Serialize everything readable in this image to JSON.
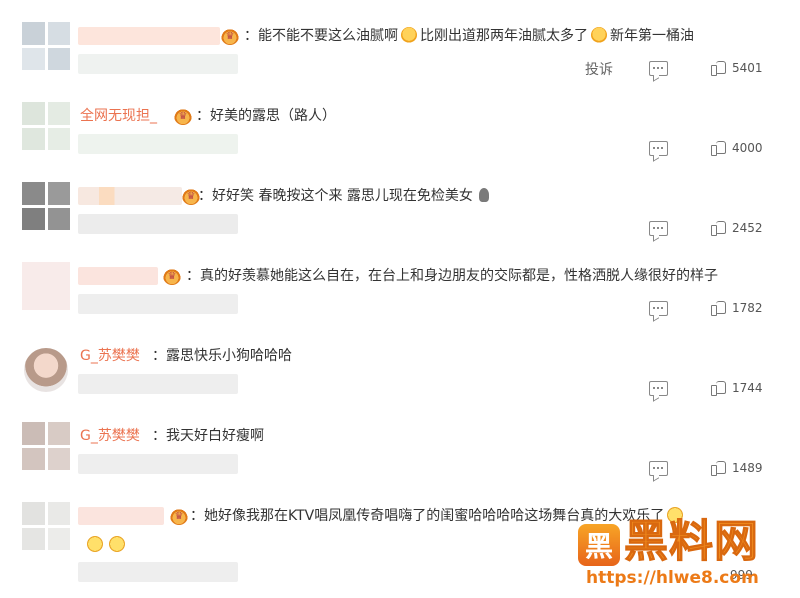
{
  "comments": [
    {
      "text": "能不能不要这么油腻啊",
      "text2": "比刚出道那两年油腻太多了",
      "text3": "新年第一桶油",
      "report": "投诉",
      "likes": "5401"
    },
    {
      "name": "全网无现担_",
      "text": "好美的露思（路人）",
      "likes": "4000"
    },
    {
      "text": "好好笑 春晚按这个来 露思儿现在免检美女",
      "likes": "2452"
    },
    {
      "text": "真的好羡慕她能这么自在，在台上和身边朋友的交际都是，性格洒脱人缘很好的样子",
      "likes": "1782"
    },
    {
      "name": "G_苏樊樊",
      "text": "露思快乐小狗哈哈哈",
      "likes": "1744"
    },
    {
      "name": "G_苏樊樊",
      "text": "我天好白好瘦啊",
      "likes": "1489"
    },
    {
      "text": "她好像我那在KTV唱凤凰传奇唱嗨了的闺蜜哈哈哈哈这场舞台真的大欢乐了",
      "likes": "999"
    }
  ],
  "watermark": {
    "logo": "黑",
    "title": "黑料网",
    "url": "https://hlwe8.com"
  },
  "colors": {
    "name_link": "#eb7350",
    "text": "#333333",
    "meta": "#808080"
  }
}
